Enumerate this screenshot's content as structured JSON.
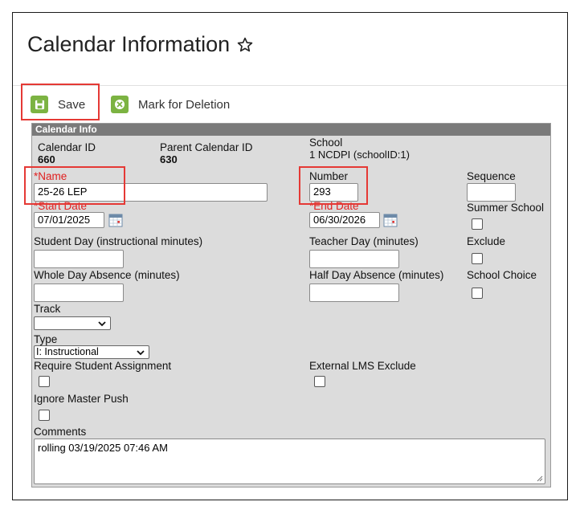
{
  "page": {
    "title": "Calendar Information"
  },
  "toolbar": {
    "save_label": "Save",
    "delete_label": "Mark for Deletion"
  },
  "panel": {
    "header": "Calendar Info",
    "calendar_id": {
      "label": "Calendar ID",
      "value": "660"
    },
    "parent_calendar_id": {
      "label": "Parent Calendar ID",
      "value": "630"
    },
    "school": {
      "label": "School",
      "value": "1 NCDPI (schoolID:1)"
    },
    "name": {
      "label": "*Name",
      "value": "25-26 LEP"
    },
    "number": {
      "label": "Number",
      "value": "293"
    },
    "sequence": {
      "label": "Sequence",
      "value": ""
    },
    "start_date": {
      "label": "*Start Date",
      "value": "07/01/2025"
    },
    "end_date": {
      "label": "*End Date",
      "value": "06/30/2026"
    },
    "summer_school": {
      "label": "Summer School"
    },
    "student_day": {
      "label": "Student Day (instructional minutes)",
      "value": ""
    },
    "teacher_day": {
      "label": "Teacher Day (minutes)",
      "value": ""
    },
    "exclude": {
      "label": "Exclude"
    },
    "whole_day_absence": {
      "label": "Whole Day Absence (minutes)",
      "value": ""
    },
    "half_day_absence": {
      "label": "Half Day Absence (minutes)",
      "value": ""
    },
    "school_choice": {
      "label": "School Choice"
    },
    "track": {
      "label": "Track",
      "value": ""
    },
    "type": {
      "label": "Type",
      "value": "I: Instructional"
    },
    "require_student_assignment": {
      "label": "Require Student Assignment"
    },
    "external_lms_exclude": {
      "label": "External LMS Exclude"
    },
    "ignore_master_push": {
      "label": "Ignore Master Push"
    },
    "comments": {
      "label": "Comments",
      "value": "rolling 03/19/2025 07:46 AM"
    }
  },
  "colors": {
    "accent_green": "#7cb342",
    "required_red": "#e02020",
    "highlight_red": "#e53935",
    "panel_header": "#7a7a7a"
  },
  "icons": {
    "save": "floppy-disk-icon",
    "delete": "x-circle-icon",
    "favorite": "star-outline-icon",
    "date_picker": "calendar-icon"
  }
}
